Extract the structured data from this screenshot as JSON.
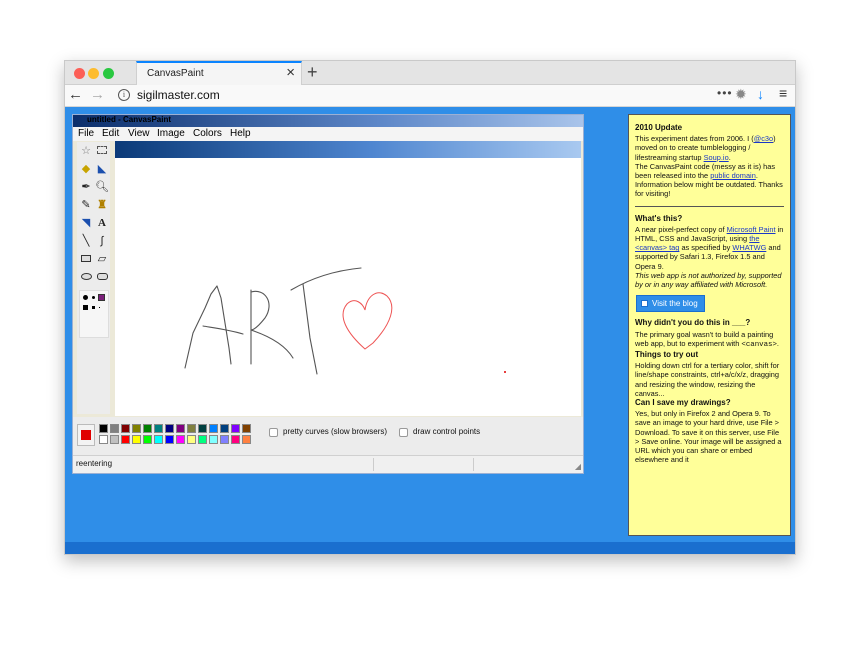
{
  "browser": {
    "tab_title": "CanvasPaint",
    "tab_close": "×",
    "new_tab": "+",
    "url": "sigilmaster.com",
    "back": "←",
    "forward": "→",
    "info": "i",
    "page_actions": "•••",
    "download_icon": "↓",
    "menu_icon": "≡"
  },
  "paint": {
    "title": "untitled - CanvasPaint",
    "menu": [
      "File",
      "Edit",
      "View",
      "Image",
      "Colors",
      "Help"
    ],
    "tools": [
      "free-select",
      "rect-select",
      "eraser",
      "fill",
      "color-picker",
      "magnifier",
      "pencil",
      "brush",
      "airbrush",
      "text",
      "line",
      "curve",
      "rectangle",
      "polygon",
      "ellipse",
      "rounded-rectangle"
    ],
    "current_color": "#e00000",
    "palette_top": [
      "#000000",
      "#808080",
      "#800000",
      "#808000",
      "#008000",
      "#008080",
      "#000080",
      "#800080",
      "#808040",
      "#004040",
      "#0080ff",
      "#004080",
      "#8000ff",
      "#804000"
    ],
    "palette_bottom": [
      "#ffffff",
      "#c0c0c0",
      "#ff0000",
      "#ffff00",
      "#00ff00",
      "#00ffff",
      "#0000ff",
      "#ff00ff",
      "#ffff80",
      "#00ff80",
      "#80ffff",
      "#8080ff",
      "#ff0080",
      "#ff8040"
    ],
    "option_pretty_curves": "pretty curves (slow browsers)",
    "option_control_points": "draw control points",
    "status": "reentering"
  },
  "panel": {
    "update_title": "2010 Update",
    "update_l1": "This experiment dates from 2006. I (",
    "update_link1": "@c3o",
    "update_l2": ") moved on to create tumblelogging / lifestreaming startup ",
    "update_link2": "Soup.io",
    "update_l3": ".",
    "update_l4": "The CanvasPaint code (messy as it is) has been released into the ",
    "update_link3": "public domain",
    "update_l5": ". Information below might be outdated. Thanks for visiting!",
    "whats_title": "What's this?",
    "whats_l1": "A near pixel-perfect copy of ",
    "whats_link1": "Microsoft Paint",
    "whats_l2": " in HTML, CSS and JavaScript, using ",
    "whats_link2": "the <canvas> tag",
    "whats_l3": " as specified by ",
    "whats_link3": "WHATWG",
    "whats_l4": " and supported by Safari 1.3, Firefox 1.5 and Opera 9.",
    "whats_disclaimer": "This web app is not authorized by, supported by or in any way affiliated with Microsoft.",
    "visit_button": "Visit the blog",
    "why_title": "Why didn't you do this in ___?",
    "why_l1": "The primary goal wasn't to build a painting web app, but to experiment with ",
    "why_mono": "<canvas>",
    "why_l2": ".",
    "try_title": "Things to try out",
    "try_body": "Holding down ctrl for a tertiary color, shift for line/shape constraints, ctrl+a/c/x/z, dragging and resizing the window, resizing the canvas...",
    "save_title": "Can I save my drawings?",
    "save_body": "Yes, but only in Firefox 2 and Opera 9. To save an image to your hard drive, use File > Download. To save it on this server, use File > Save online. Your image will be assigned a URL which you can share or embed elsewhere and it"
  }
}
